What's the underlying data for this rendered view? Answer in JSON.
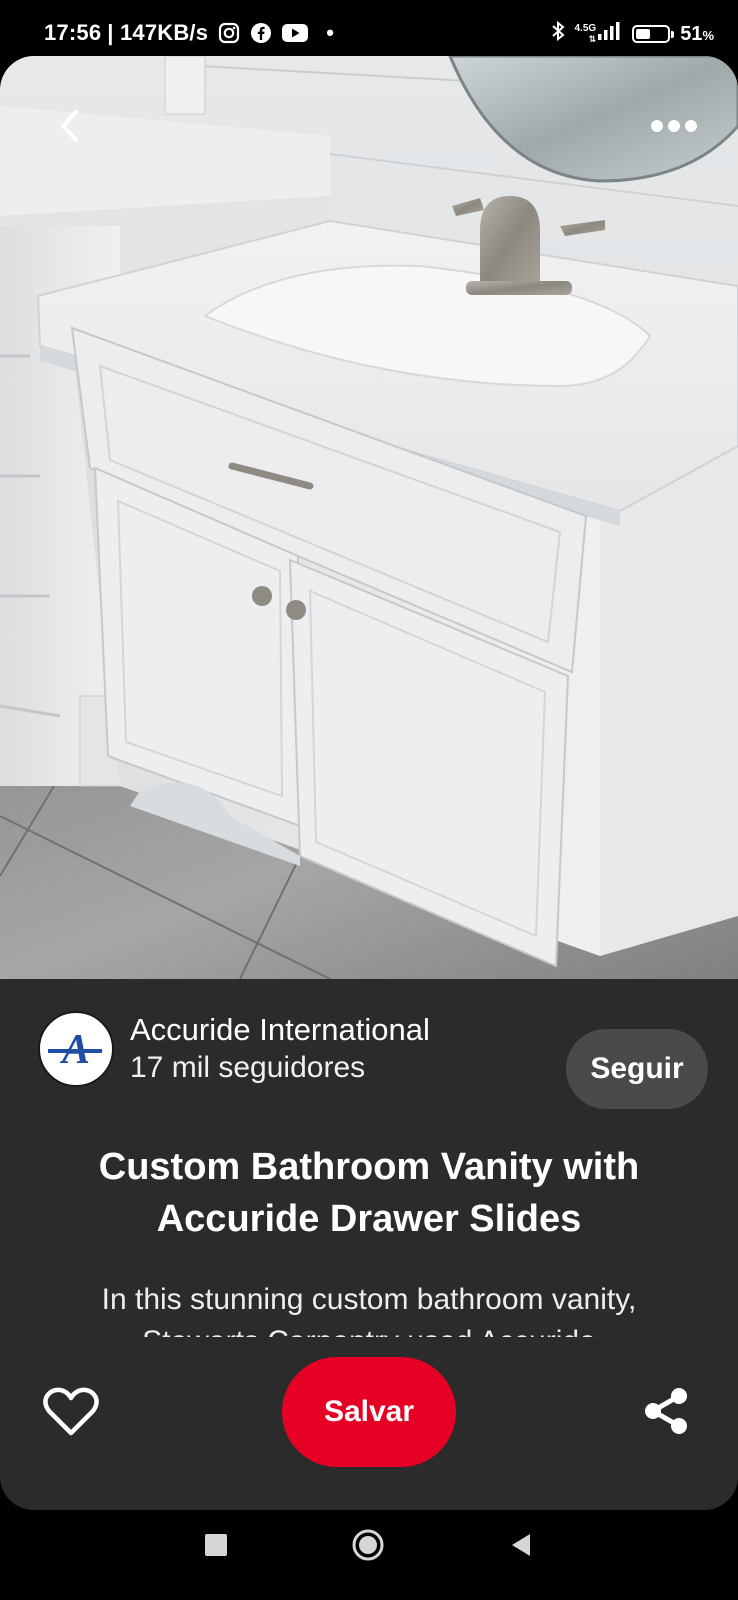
{
  "status_bar": {
    "time": "17:56",
    "speed": "| 147KB/s",
    "network_top": "4.5G",
    "network_bottom": "⇅",
    "battery_percent": "51",
    "battery_unit": "%",
    "battery_level": 0.51,
    "notification_dot": "•"
  },
  "pin": {
    "image_alt": "Custom white bathroom vanity with sink and drawer",
    "creator": {
      "name": "Accuride International",
      "followers": "17 mil seguidores",
      "avatar_letter": "A"
    },
    "follow_label": "Seguir",
    "title": "Custom Bathroom Vanity with Accuride Drawer Slides",
    "description": "In this stunning custom bathroom vanity, Stewarts Carpentry used Accuride"
  },
  "actions": {
    "save_label": "Salvar"
  },
  "colors": {
    "save_red": "#e60023",
    "panel_bg": "#2b2b2b",
    "follow_bg": "#4a4a4a",
    "brand_blue": "#1f4ea3"
  },
  "icons": [
    "back-icon",
    "more-icon",
    "heart-icon",
    "share-icon",
    "instagram-icon",
    "facebook-icon",
    "youtube-icon",
    "bluetooth-icon",
    "signal-icon",
    "battery-icon"
  ]
}
